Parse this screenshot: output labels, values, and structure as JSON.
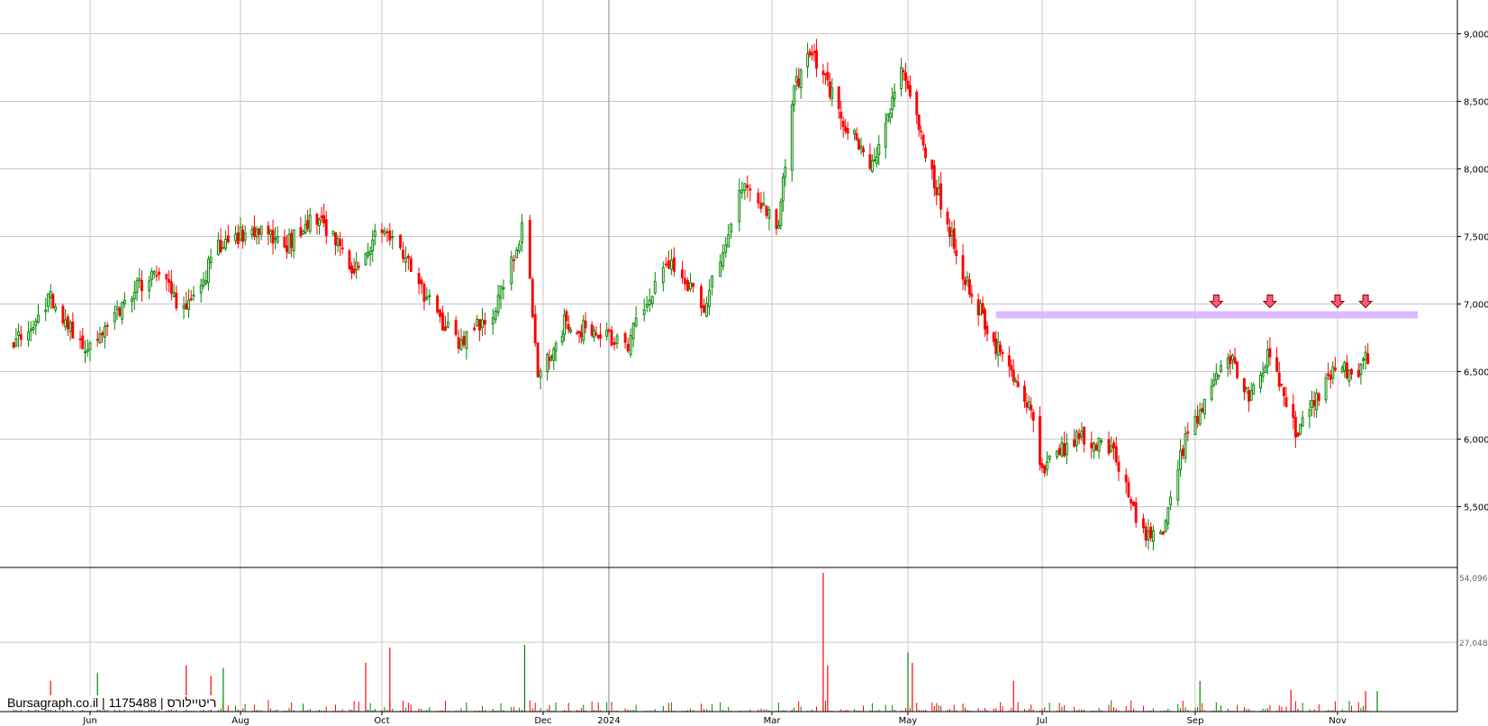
{
  "chart_data": {
    "type": "candlestick",
    "watermark": "Bursagraph.co.il | 1175488 | ריטיילורס",
    "price_axis": {
      "ticks": [
        5500,
        6000,
        6500,
        7000,
        7500,
        8000,
        8500,
        9000
      ],
      "tick_labels": [
        "5,500",
        "6,000",
        "6,500",
        "7,000",
        "7,500",
        "8,000",
        "8,500",
        "9,000"
      ],
      "range": [
        5050,
        9250
      ]
    },
    "volume_axis": {
      "ticks": [
        27048,
        54096
      ],
      "tick_labels": [
        "27,048",
        "54,096"
      ],
      "range": [
        0,
        54096
      ]
    },
    "x_axis": {
      "labels": [
        "Jun",
        "Aug",
        "Oct",
        "Dec",
        "2024",
        "Mar",
        "May",
        "Jul",
        "Sep",
        "Nov"
      ]
    },
    "grid": true,
    "colors": {
      "up": "#008800",
      "down": "#ff0000",
      "resistance": "#d9b3ff",
      "arrow": "#ff5a7a"
    },
    "resistance_level": 6920,
    "resistance_start_date": "2024-06-10",
    "arrow_dates": [
      "2024-09-10",
      "2024-10-03",
      "2024-11-01",
      "2024-11-13"
    ],
    "path": [
      [
        "2023-05-01",
        6700
      ],
      [
        "2023-05-16",
        7050
      ],
      [
        "2023-05-29",
        6650
      ],
      [
        "2023-06-12",
        6950
      ],
      [
        "2023-06-26",
        7250
      ],
      [
        "2023-07-10",
        6950
      ],
      [
        "2023-07-24",
        7450
      ],
      [
        "2023-08-07",
        7550
      ],
      [
        "2023-08-21",
        7450
      ],
      [
        "2023-09-04",
        7650
      ],
      [
        "2023-09-18",
        7250
      ],
      [
        "2023-10-02",
        7600
      ],
      [
        "2023-10-16",
        7100
      ],
      [
        "2023-10-30",
        6700
      ],
      [
        "2023-11-13",
        6950
      ],
      [
        "2023-11-24",
        7600
      ],
      [
        "2023-11-29",
        6500
      ],
      [
        "2023-12-11",
        6850
      ],
      [
        "2023-12-25",
        6800
      ],
      [
        "2024-01-08",
        6700
      ],
      [
        "2024-01-22",
        7350
      ],
      [
        "2024-02-05",
        7000
      ],
      [
        "2024-02-19",
        7850
      ],
      [
        "2024-03-04",
        7600
      ],
      [
        "2024-03-11",
        8600
      ],
      [
        "2024-03-19",
        8850
      ],
      [
        "2024-04-01",
        8400
      ],
      [
        "2024-04-15",
        8000
      ],
      [
        "2024-04-29",
        8750
      ],
      [
        "2024-05-13",
        7900
      ],
      [
        "2024-05-27",
        7200
      ],
      [
        "2024-06-10",
        6700
      ],
      [
        "2024-06-24",
        6300
      ],
      [
        "2024-07-01",
        5800
      ],
      [
        "2024-07-15",
        6000
      ],
      [
        "2024-07-29",
        5950
      ],
      [
        "2024-08-05",
        5600
      ],
      [
        "2024-08-12",
        5250
      ],
      [
        "2024-08-19",
        5350
      ],
      [
        "2024-08-26",
        5900
      ],
      [
        "2024-09-10",
        6500
      ],
      [
        "2024-09-17",
        6600
      ],
      [
        "2024-09-24",
        6300
      ],
      [
        "2024-10-03",
        6650
      ],
      [
        "2024-10-14",
        6050
      ],
      [
        "2024-10-21",
        6250
      ],
      [
        "2024-11-01",
        6600
      ],
      [
        "2024-11-08",
        6400
      ],
      [
        "2024-11-13",
        6700
      ],
      [
        "2024-11-15",
        6550
      ]
    ],
    "volume_spikes": [
      [
        "2023-05-16",
        12000
      ],
      [
        "2023-06-04",
        15000
      ],
      [
        "2023-07-10",
        18000
      ],
      [
        "2023-07-20",
        14000
      ],
      [
        "2023-07-25",
        17000
      ],
      [
        "2023-09-24",
        19000
      ],
      [
        "2023-10-04",
        25000
      ],
      [
        "2023-11-24",
        26000
      ],
      [
        "2024-03-24",
        54096
      ],
      [
        "2024-03-26",
        18000
      ],
      [
        "2024-05-01",
        23000
      ],
      [
        "2024-05-03",
        19000
      ],
      [
        "2024-06-18",
        12000
      ],
      [
        "2024-09-03",
        12000
      ],
      [
        "2024-10-12",
        8500
      ],
      [
        "2024-11-13",
        8000
      ],
      [
        "2024-11-18",
        8000
      ]
    ]
  }
}
